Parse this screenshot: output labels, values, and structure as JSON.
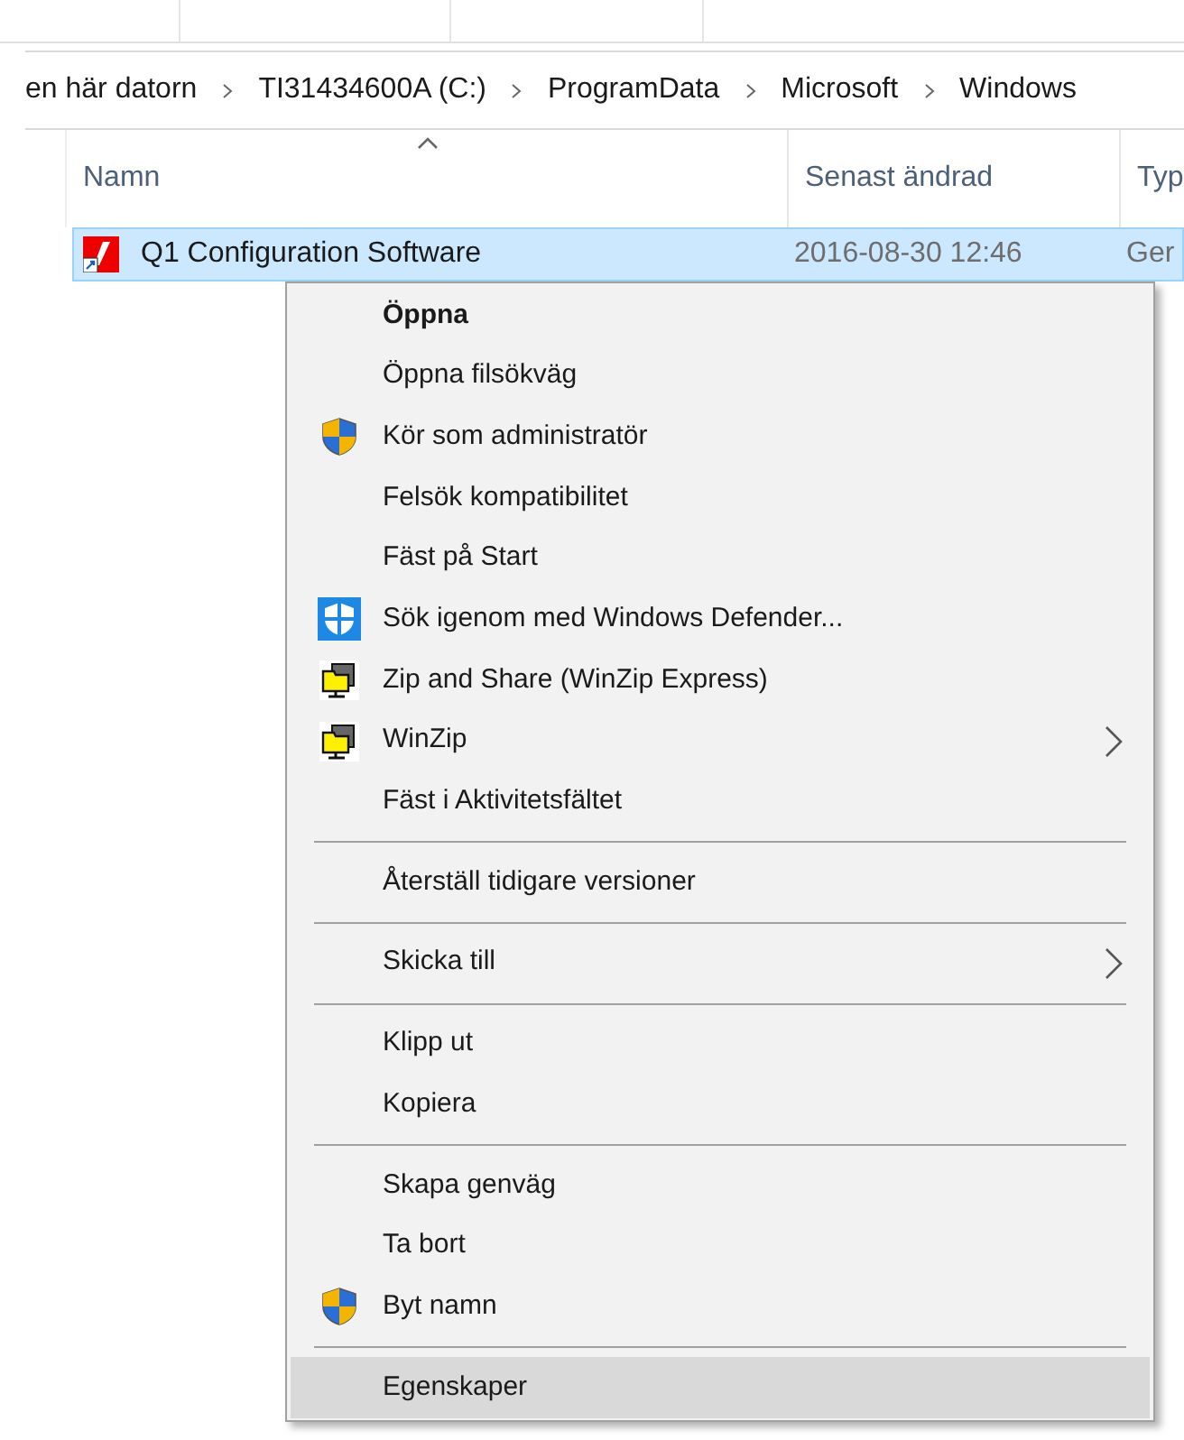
{
  "breadcrumb": [
    "en här datorn",
    "TI31434600A (C:)",
    "ProgramData",
    "Microsoft",
    "Windows"
  ],
  "columns": [
    {
      "label": "Namn",
      "sorted": true
    },
    {
      "label": "Senast ändrad",
      "sorted": false
    },
    {
      "label": "Typ",
      "sorted": false
    }
  ],
  "files": [
    {
      "name": "Q1 Configuration Software",
      "modified": "2016-08-30 12:46",
      "type": "Ger",
      "selected": true
    }
  ],
  "context_menu": [
    {
      "kind": "plain",
      "label": "Öppna",
      "bold": true,
      "submenu": false,
      "selected": false
    },
    {
      "kind": "plain",
      "label": "Öppna filsökväg",
      "bold": false,
      "submenu": false,
      "selected": false
    },
    {
      "kind": "shield",
      "label": "Kör som administratör",
      "bold": false,
      "submenu": false,
      "selected": false
    },
    {
      "kind": "plain",
      "label": "Felsök kompatibilitet",
      "bold": false,
      "submenu": false,
      "selected": false
    },
    {
      "kind": "plain",
      "label": "Fäst på Start",
      "bold": false,
      "submenu": false,
      "selected": false
    },
    {
      "kind": "defender",
      "label": "Sök igenom med Windows Defender...",
      "bold": false,
      "submenu": false,
      "selected": false
    },
    {
      "kind": "winzip",
      "label": "Zip and Share (WinZip Express)",
      "bold": false,
      "submenu": false,
      "selected": false
    },
    {
      "kind": "winzip",
      "label": "WinZip",
      "bold": false,
      "submenu": true,
      "selected": false
    },
    {
      "kind": "plain",
      "label": "Fäst i Aktivitetsfältet",
      "bold": false,
      "submenu": false,
      "selected": false
    },
    {
      "kind": "separator"
    },
    {
      "kind": "plain",
      "label": "Återställ tidigare versioner",
      "bold": false,
      "submenu": false,
      "selected": false
    },
    {
      "kind": "separator"
    },
    {
      "kind": "plain",
      "label": "Skicka till",
      "bold": false,
      "submenu": true,
      "selected": false
    },
    {
      "kind": "separator"
    },
    {
      "kind": "plain",
      "label": "Klipp ut",
      "bold": false,
      "submenu": false,
      "selected": false
    },
    {
      "kind": "plain",
      "label": "Kopiera",
      "bold": false,
      "submenu": false,
      "selected": false
    },
    {
      "kind": "separator"
    },
    {
      "kind": "plain",
      "label": "Skapa genväg",
      "bold": false,
      "submenu": false,
      "selected": false
    },
    {
      "kind": "plain",
      "label": "Ta bort",
      "bold": false,
      "submenu": false,
      "selected": false
    },
    {
      "kind": "shield",
      "label": "Byt namn",
      "bold": false,
      "submenu": false,
      "selected": false
    },
    {
      "kind": "separator"
    },
    {
      "kind": "plain",
      "label": "Egenskaper",
      "bold": false,
      "submenu": false,
      "selected": true
    }
  ]
}
